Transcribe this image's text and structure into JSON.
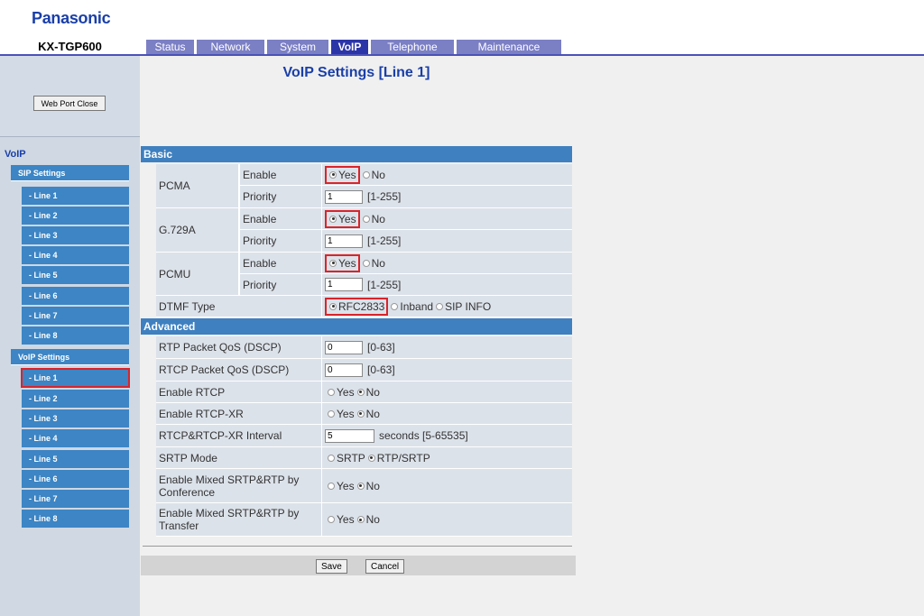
{
  "header": {
    "brand": "Panasonic",
    "model": "KX-TGP600",
    "tabs": [
      {
        "label": "Status",
        "width": 0
      },
      {
        "label": "Network"
      },
      {
        "label": "System"
      },
      {
        "label": "VoIP"
      },
      {
        "label": "Telephone"
      },
      {
        "label": "Maintenance"
      }
    ]
  },
  "sidebar": {
    "web_port_close": "Web Port Close",
    "section": "VoIP",
    "sip_group": "SIP Settings",
    "sip_lines": [
      "- Line 1",
      "- Line 2",
      "- Line 3",
      "- Line 4",
      "- Line 5",
      "- Line 6",
      "- Line 7",
      "- Line 8"
    ],
    "voip_group": "VoIP Settings",
    "voip_lines": [
      "- Line 1",
      "- Line 2",
      "- Line 3",
      "- Line 4",
      "- Line 5",
      "- Line 6",
      "- Line 7",
      "- Line 8"
    ]
  },
  "page": {
    "title": "VoIP Settings [Line 1]",
    "basic_head": "Basic",
    "advanced_head": "Advanced",
    "codecs": [
      {
        "name": "PCMA",
        "enable_label": "Enable",
        "priority_label": "Priority",
        "yes": "Yes",
        "no": "No",
        "priority": "1",
        "range": "[1-255]"
      },
      {
        "name": "G.729A",
        "enable_label": "Enable",
        "priority_label": "Priority",
        "yes": "Yes",
        "no": "No",
        "priority": "1",
        "range": "[1-255]"
      },
      {
        "name": "PCMU",
        "enable_label": "Enable",
        "priority_label": "Priority",
        "yes": "Yes",
        "no": "No",
        "priority": "1",
        "range": "[1-255]"
      }
    ],
    "dtmf": {
      "label": "DTMF Type",
      "opt1": "RFC2833",
      "opt2": "Inband",
      "opt3": "SIP INFO"
    },
    "advanced": {
      "rtp_qos_label": "RTP Packet QoS (DSCP)",
      "rtp_qos": "0",
      "rtp_qos_range": "[0-63]",
      "rtcp_qos_label": "RTCP Packet QoS (DSCP)",
      "rtcp_qos": "0",
      "rtcp_qos_range": "[0-63]",
      "rtcp_label": "Enable RTCP",
      "rtcpxr_label": "Enable RTCP-XR",
      "interval_label": "RTCP&RTCP-XR Interval",
      "interval": "5",
      "interval_range": "seconds [5-65535]",
      "srtp_label": "SRTP Mode",
      "srtp_opt1": "SRTP",
      "srtp_opt2": "RTP/SRTP",
      "mixed_conf_label": "Enable Mixed SRTP&RTP by Conference",
      "mixed_xfer_label": "Enable Mixed SRTP&RTP by Transfer",
      "yes": "Yes",
      "no": "No"
    },
    "save": "Save",
    "cancel": "Cancel"
  }
}
